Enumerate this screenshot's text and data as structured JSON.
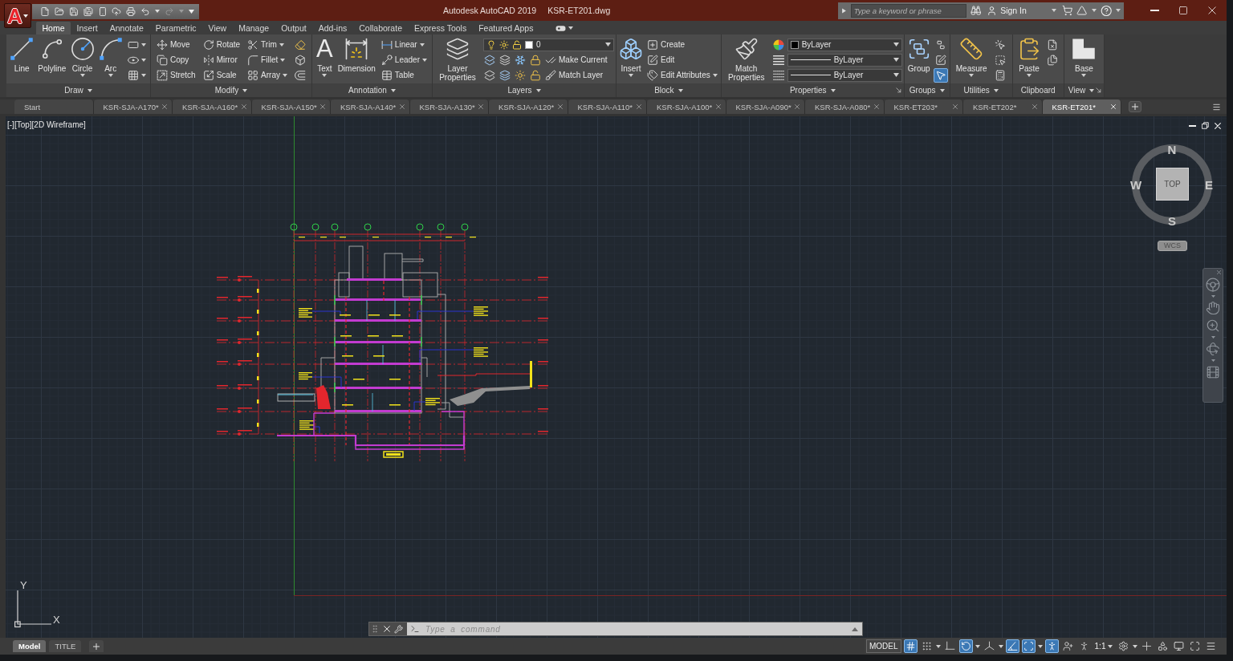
{
  "app_menu": {
    "glyph": "A"
  },
  "quick_access": [
    {
      "disabled": false
    },
    {
      "disabled": false
    },
    {
      "disabled": false
    },
    {
      "disabled": false
    },
    {
      "disabled": false
    },
    {
      "disabled": false
    },
    {
      "disabled": false
    },
    {
      "disabled": false
    },
    {
      "disabled": true
    }
  ],
  "title_bar": {
    "app_name": "Autodesk AutoCAD 2019",
    "file_name": "KSR-ET201.dwg",
    "search": {
      "placeholder": "Type a keyword or phrase"
    },
    "sign_in": "Sign In"
  },
  "ribbon_tabs": [
    {
      "label": "Home",
      "selected": true
    },
    {
      "label": "Insert",
      "selected": false
    },
    {
      "label": "Annotate",
      "selected": false
    },
    {
      "label": "Parametric",
      "selected": false
    },
    {
      "label": "View",
      "selected": false
    },
    {
      "label": "Manage",
      "selected": false
    },
    {
      "label": "Output",
      "selected": false
    },
    {
      "label": "Add-ins",
      "selected": false
    },
    {
      "label": "Collaborate",
      "selected": false
    },
    {
      "label": "Express Tools",
      "selected": false
    },
    {
      "label": "Featured Apps",
      "selected": false
    }
  ],
  "ribbon_panels": [
    {
      "title": "Draw",
      "menu": true,
      "launcher": false,
      "columns": [
        {
          "kind": "large",
          "label": "Line",
          "caret": false
        },
        {
          "kind": "large",
          "label": "Polyline",
          "caret": false
        },
        {
          "kind": "large",
          "label": "Circle",
          "caret": true
        },
        {
          "kind": "large",
          "label": "Arc",
          "caret": true
        },
        {
          "kind": "stack",
          "rows": [
            {
              "tools": [
                {
                  "kind": "small",
                  "caret": true
                }
              ]
            },
            {
              "tools": [
                {
                  "kind": "small",
                  "caret": true
                }
              ]
            },
            {
              "tools": [
                {
                  "kind": "small",
                  "caret": true
                }
              ]
            }
          ]
        }
      ]
    },
    {
      "title": "Modify",
      "menu": true,
      "launcher": false,
      "columns": [
        {
          "kind": "stack",
          "rows": [
            {
              "tools": [
                {
                  "kind": "small",
                  "label": "Move",
                  "caret": false
                }
              ]
            },
            {
              "tools": [
                {
                  "kind": "small",
                  "label": "Copy",
                  "caret": false
                }
              ]
            },
            {
              "tools": [
                {
                  "kind": "small",
                  "label": "Stretch",
                  "caret": false
                }
              ]
            }
          ]
        },
        {
          "kind": "stack",
          "rows": [
            {
              "tools": [
                {
                  "kind": "small",
                  "label": "Rotate",
                  "caret": false
                }
              ]
            },
            {
              "tools": [
                {
                  "kind": "small",
                  "label": "Mirror",
                  "caret": false
                }
              ]
            },
            {
              "tools": [
                {
                  "kind": "small",
                  "label": "Scale",
                  "caret": false
                }
              ]
            }
          ]
        },
        {
          "kind": "stack",
          "rows": [
            {
              "tools": [
                {
                  "kind": "small",
                  "label": "Trim",
                  "caret": true
                }
              ]
            },
            {
              "tools": [
                {
                  "kind": "small",
                  "label": "Fillet",
                  "caret": true
                }
              ]
            },
            {
              "tools": [
                {
                  "kind": "small",
                  "label": "Array",
                  "caret": true
                }
              ]
            }
          ]
        },
        {
          "kind": "stack",
          "rows": [
            {
              "tools": [
                {
                  "kind": "small",
                  "caret": false
                }
              ]
            },
            {
              "tools": [
                {
                  "kind": "small",
                  "caret": false
                }
              ]
            },
            {
              "tools": [
                {
                  "kind": "small",
                  "caret": false
                }
              ]
            }
          ]
        }
      ]
    },
    {
      "title": "Annotation",
      "menu": true,
      "launcher": false,
      "columns": [
        {
          "kind": "large",
          "label": "Text",
          "glyph": "A",
          "caret": true
        },
        {
          "kind": "large",
          "label": "Dimension",
          "caret": false
        },
        {
          "kind": "stack",
          "rows": [
            {
              "tools": [
                {
                  "kind": "small",
                  "label": "Linear",
                  "caret": true
                }
              ]
            },
            {
              "tools": [
                {
                  "kind": "small",
                  "label": "Leader",
                  "caret": true
                }
              ]
            },
            {
              "tools": [
                {
                  "kind": "small",
                  "label": "Table",
                  "caret": false
                }
              ]
            }
          ]
        }
      ]
    },
    {
      "title": "Layers",
      "menu": true,
      "launcher": false,
      "columns": [
        {
          "kind": "large",
          "label": "Layer Properties",
          "caret": false
        },
        {
          "kind": "stack",
          "rows": [
            {
              "tools": [
                {
                  "kind": "layer_combo",
                  "value": "0"
                }
              ]
            },
            {
              "tools": [
                {
                  "kind": "small",
                  "caret": false
                },
                {
                  "kind": "small",
                  "caret": false
                },
                {
                  "kind": "small",
                  "caret": false
                },
                {
                  "kind": "small",
                  "caret": false
                },
                {
                  "kind": "small",
                  "label": "Make Current",
                  "caret": false
                }
              ]
            },
            {
              "tools": [
                {
                  "kind": "small",
                  "caret": false
                },
                {
                  "kind": "small",
                  "caret": false
                },
                {
                  "kind": "small",
                  "caret": false
                },
                {
                  "kind": "small",
                  "caret": false
                },
                {
                  "kind": "small",
                  "label": "Match Layer",
                  "caret": false
                }
              ]
            }
          ]
        }
      ]
    },
    {
      "title": "Block",
      "menu": true,
      "launcher": false,
      "columns": [
        {
          "kind": "large",
          "label": "Insert",
          "caret": true
        },
        {
          "kind": "stack",
          "rows": [
            {
              "tools": [
                {
                  "kind": "small",
                  "label": "Create",
                  "caret": false
                }
              ]
            },
            {
              "tools": [
                {
                  "kind": "small",
                  "label": "Edit",
                  "caret": false
                }
              ]
            },
            {
              "tools": [
                {
                  "kind": "small",
                  "label": "Edit Attributes",
                  "caret": true
                }
              ]
            }
          ]
        }
      ]
    },
    {
      "title": "Properties",
      "menu": true,
      "launcher": true,
      "columns": [
        {
          "kind": "large",
          "label": "Match Properties",
          "caret": false
        },
        {
          "kind": "stack",
          "rows": [
            {
              "tools": [
                {
                  "kind": "small",
                  "caret": false
                },
                {
                  "kind": "swatch_combo",
                  "value": "ByLayer"
                }
              ]
            },
            {
              "tools": [
                {
                  "kind": "small",
                  "caret": false
                },
                {
                  "kind": "line_combo",
                  "value": "ByLayer"
                }
              ]
            },
            {
              "tools": [
                {
                  "kind": "small",
                  "caret": false
                },
                {
                  "kind": "line_combo",
                  "value": "ByLayer"
                }
              ]
            }
          ]
        }
      ]
    },
    {
      "title": "Groups",
      "menu": true,
      "launcher": false,
      "columns": [
        {
          "kind": "large",
          "label": "Group",
          "caret": false
        },
        {
          "kind": "stack",
          "rows": [
            {
              "tools": [
                {
                  "kind": "small",
                  "caret": false,
                  "on": false
                }
              ]
            },
            {
              "tools": [
                {
                  "kind": "small",
                  "caret": false,
                  "on": false
                }
              ]
            },
            {
              "tools": [
                {
                  "kind": "small",
                  "caret": false,
                  "on": true
                }
              ]
            }
          ]
        }
      ]
    },
    {
      "title": "Utilities",
      "menu": true,
      "launcher": false,
      "columns": [
        {
          "kind": "large",
          "label": "Measure",
          "caret": true
        },
        {
          "kind": "stack",
          "rows": [
            {
              "tools": [
                {
                  "kind": "small",
                  "caret": false
                }
              ]
            },
            {
              "tools": [
                {
                  "kind": "small",
                  "caret": false
                }
              ]
            },
            {
              "tools": [
                {
                  "kind": "small",
                  "caret": false
                }
              ]
            }
          ]
        }
      ]
    },
    {
      "title": "Clipboard",
      "menu": false,
      "launcher": false,
      "columns": [
        {
          "kind": "large",
          "label": "Paste",
          "caret": true
        },
        {
          "kind": "stack",
          "rows": [
            {
              "tools": [
                {
                  "kind": "small",
                  "caret": false
                }
              ]
            },
            {
              "tools": [
                {
                  "kind": "small",
                  "caret": false
                }
              ]
            }
          ]
        }
      ]
    },
    {
      "title": "View",
      "menu": true,
      "launcher": true,
      "columns": [
        {
          "kind": "large",
          "label": "Base",
          "caret": true
        }
      ]
    }
  ],
  "file_tabs": [
    {
      "label": "Start",
      "selected": false,
      "closable": false
    },
    {
      "label": "KSR-SJA-A170*",
      "selected": false,
      "closable": true
    },
    {
      "label": "KSR-SJA-A160*",
      "selected": false,
      "closable": true
    },
    {
      "label": "KSR-SJA-A150*",
      "selected": false,
      "closable": true
    },
    {
      "label": "KSR-SJA-A140*",
      "selected": false,
      "closable": true
    },
    {
      "label": "KSR-SJA-A130*",
      "selected": false,
      "closable": true
    },
    {
      "label": "KSR-SJA-A120*",
      "selected": false,
      "closable": true
    },
    {
      "label": "KSR-SJA-A110*",
      "selected": false,
      "closable": true
    },
    {
      "label": "KSR-SJA-A100*",
      "selected": false,
      "closable": true
    },
    {
      "label": "KSR-SJA-A090*",
      "selected": false,
      "closable": true
    },
    {
      "label": "KSR-SJA-A080*",
      "selected": false,
      "closable": true
    },
    {
      "label": "KSR-ET203*",
      "selected": false,
      "closable": true
    },
    {
      "label": "KSR-ET202*",
      "selected": false,
      "closable": true
    },
    {
      "label": "KSR-ET201*",
      "selected": true,
      "closable": true
    }
  ],
  "viewport": {
    "controls": "[-][Top][2D Wireframe]",
    "compass": {
      "north": "N",
      "east": "E",
      "south": "S",
      "west": "W"
    },
    "view_face": "TOP",
    "coordinate_system": "WCS",
    "ucs": {
      "x": "X",
      "y": "Y"
    }
  },
  "command_line": {
    "placeholder": "Type a command"
  },
  "layout_tabs": [
    {
      "label": "Model",
      "selected": true
    },
    {
      "label": "TITLE",
      "selected": false
    }
  ],
  "status_bar": {
    "space": "MODEL",
    "toggles": [
      {
        "on": true
      },
      {
        "on": false
      },
      {
        "on": false
      },
      {
        "on": true
      },
      {
        "on": false
      },
      {
        "on": true
      },
      {
        "on": true
      },
      {
        "on": true
      },
      {
        "on": false
      },
      {
        "on": false
      }
    ],
    "scale": "1:1"
  }
}
